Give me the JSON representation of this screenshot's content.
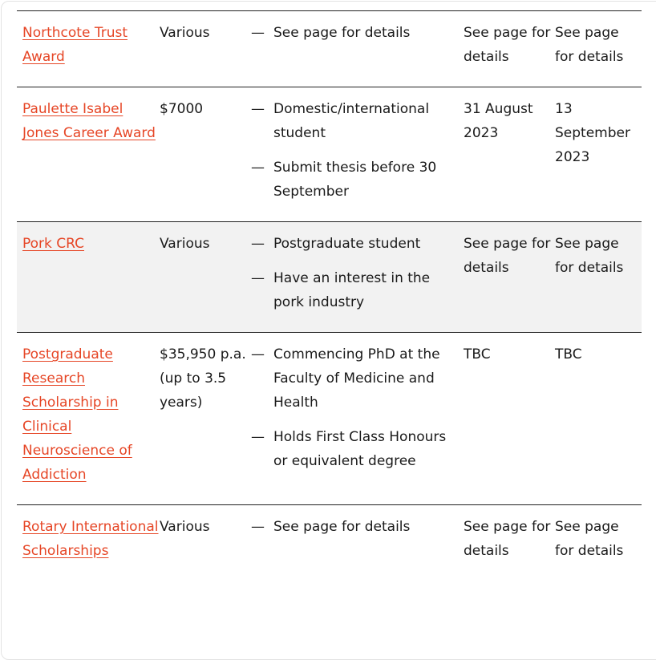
{
  "accent_color": "#e64626",
  "rows": [
    {
      "name": "Northcote Trust Award",
      "amount": "Various",
      "eligibility": [
        "See page for details"
      ],
      "opens": "See page for details",
      "closes": "See page for details",
      "shaded": false
    },
    {
      "name": "Paulette Isabel Jones Career Award",
      "amount": "$7000",
      "eligibility": [
        "Domestic/international student",
        "Submit thesis before 30 September"
      ],
      "opens": "31 August 2023",
      "closes": "13 September 2023",
      "shaded": false
    },
    {
      "name": "Pork CRC",
      "amount": "Various",
      "eligibility": [
        "Postgraduate student",
        "Have an interest in the pork industry"
      ],
      "opens": "See page for details",
      "closes": "See page for details",
      "shaded": true
    },
    {
      "name": "Postgraduate Research Scholarship in Clinical Neuroscience of Addiction",
      "amount": "$35,950 p.a. (up to 3.5 years)",
      "eligibility": [
        "Commencing PhD at the Faculty of Medicine and Health",
        "Holds First Class Honours or equivalent degree"
      ],
      "opens": "TBC",
      "closes": "TBC",
      "shaded": false
    },
    {
      "name": "Rotary International Scholarships",
      "amount": "Various",
      "eligibility": [
        "See page for details"
      ],
      "opens": "See page for details",
      "closes": "See page for details",
      "shaded": false
    }
  ]
}
